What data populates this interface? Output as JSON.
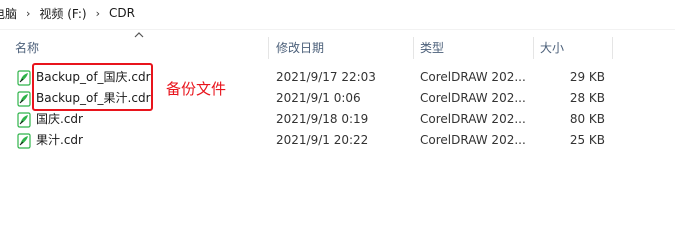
{
  "breadcrumb": {
    "items": [
      "电脑",
      "视频 (F:)",
      "CDR"
    ],
    "separator": "›"
  },
  "columns": {
    "name": "名称",
    "date": "修改日期",
    "type": "类型",
    "size": "大小"
  },
  "files": [
    {
      "name": "Backup_of_国庆.cdr",
      "date": "2021/9/17 22:03",
      "type": "CorelDRAW 202...",
      "size": "29 KB",
      "icon": "coreldraw-file-icon"
    },
    {
      "name": "Backup_of_果汁.cdr",
      "date": "2021/9/1 0:06",
      "type": "CorelDRAW 202...",
      "size": "28 KB",
      "icon": "coreldraw-file-icon"
    },
    {
      "name": "国庆.cdr",
      "date": "2021/9/18 0:19",
      "type": "CorelDRAW 202...",
      "size": "80 KB",
      "icon": "coreldraw-file-icon"
    },
    {
      "name": "果汁.cdr",
      "date": "2021/9/1 20:22",
      "type": "CorelDRAW 202...",
      "size": "25 KB",
      "icon": "coreldraw-file-icon"
    }
  ],
  "annotation": {
    "text": "备份文件",
    "color": "#e8141c"
  },
  "colors": {
    "header_text": "#4c607a",
    "icon_green": "#2fb34a"
  }
}
